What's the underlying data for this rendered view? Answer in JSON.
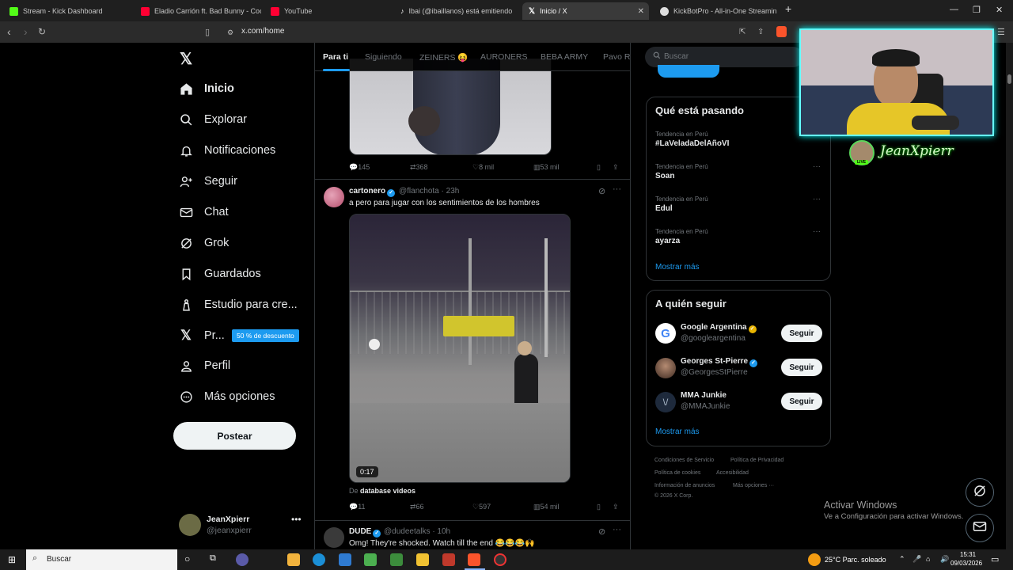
{
  "browser": {
    "tabs": [
      {
        "label": "Stream - Kick Dashboard",
        "color": "#53fc18"
      },
      {
        "label": "Eladio Carrión ft. Bad Bunny - Coco C",
        "color": "#ff0033"
      },
      {
        "label": "YouTube",
        "color": "#ff0033"
      },
      {
        "label": "Ibai (@ibaillanos) está emitiendo",
        "color": "#111111"
      },
      {
        "label": "Inicio / X",
        "color": "#ffffff"
      },
      {
        "label": "KickBotPro - All-in-One Streaming To",
        "color": "#ffffff"
      }
    ],
    "url": "x.com/home"
  },
  "sidebar": {
    "items": [
      {
        "label": "Inicio",
        "icon": "home-icon"
      },
      {
        "label": "Explorar",
        "icon": "search-icon"
      },
      {
        "label": "Notificaciones",
        "icon": "bell-icon"
      },
      {
        "label": "Seguir",
        "icon": "person-add-icon"
      },
      {
        "label": "Chat",
        "icon": "mail-icon"
      },
      {
        "label": "Grok",
        "icon": "grok-icon"
      },
      {
        "label": "Guardados",
        "icon": "bookmark-icon"
      },
      {
        "label": "Estudio para cre...",
        "icon": "studio-icon"
      },
      {
        "label": "Pr...",
        "icon": "x-logo-icon"
      },
      {
        "label": "Perfil",
        "icon": "person-icon"
      },
      {
        "label": "Más opciones",
        "icon": "more-circle-icon"
      }
    ],
    "promo_badge": "50 % de descuento",
    "post_button": "Postear",
    "account": {
      "name": "JeanXpierr",
      "handle": "@jeanxpierr"
    }
  },
  "feed": {
    "tabs": [
      "Para ti",
      "Siguiendo",
      "ZEINERS 😝",
      "AURONERS",
      "BEBA ARMY",
      "Pavo Ra"
    ],
    "prev_actions": {
      "replies": "145",
      "reposts": "368",
      "likes": "8 mil",
      "views": "53 mil"
    },
    "tweet1": {
      "name": "cartonero",
      "handle": "@flanchota",
      "time": "· 23h",
      "text": "a pero para jugar con los sentimientos de los hombres",
      "video_duration": "0:17",
      "source_prefix": "De",
      "source": "database videos",
      "actions": {
        "replies": "11",
        "reposts": "66",
        "likes": "597",
        "views": "54 mil"
      }
    },
    "tweet2": {
      "name": "DUDE",
      "handle": "@dudeetalks",
      "time": "· 10h",
      "text": "Omg! They're shocked. Watch till the end 😂😂😂🙌"
    }
  },
  "right": {
    "search_placeholder": "Buscar",
    "trends_title": "Qué está pasando",
    "trends": [
      {
        "sub": "Tendencia en Perú",
        "name": "#LaVeladaDelAñoVI"
      },
      {
        "sub": "Tendencia en Perú",
        "name": "Soan"
      },
      {
        "sub": "Tendencia en Perú",
        "name": "Edul"
      },
      {
        "sub": "Tendencia en Perú",
        "name": "ayarza"
      }
    ],
    "show_more": "Mostrar más",
    "follow_title": "A quién seguir",
    "follow": [
      {
        "name": "Google Argentina",
        "handle": "@googleargentina",
        "button": "Seguir"
      },
      {
        "name": "Georges St-Pierre",
        "handle": "@GeorgesStPierre",
        "button": "Seguir"
      },
      {
        "name": "MMA Junkie",
        "handle": "@MMAJunkie",
        "button": "Seguir"
      }
    ],
    "footer": [
      "Condiciones de Servicio",
      "Política de Privacidad",
      "Política de cookies",
      "Accesibilidad",
      "Información de anuncios",
      "Más opciones ···",
      "© 2026 X Corp."
    ]
  },
  "overlay": {
    "streamer_name": "JeanXpierr",
    "live": "LIVE",
    "activate_title": "Activar Windows",
    "activate_sub": "Ve a Configuración para activar Windows."
  },
  "taskbar": {
    "search_placeholder": "Buscar",
    "weather": "25°C  Parc. soleado",
    "time": "15:31",
    "date": "09/03/2026"
  }
}
